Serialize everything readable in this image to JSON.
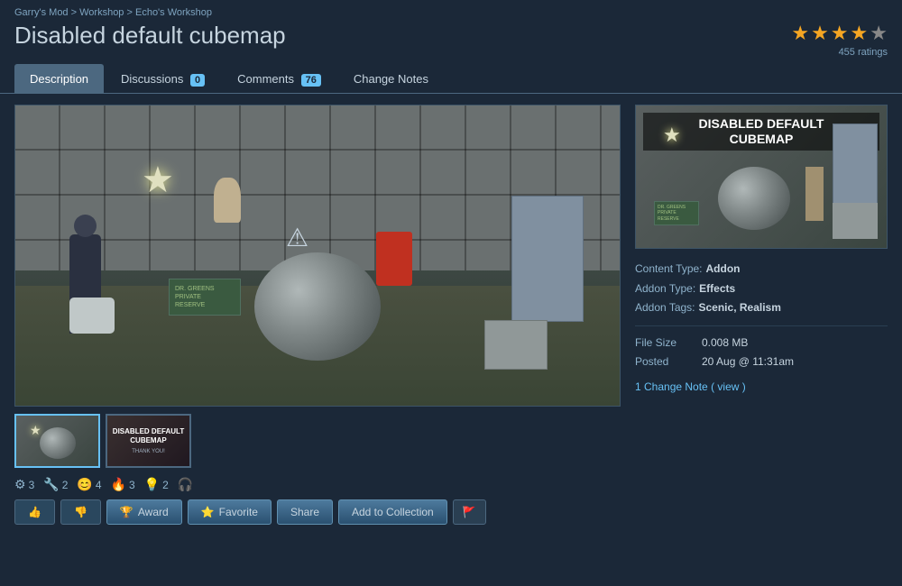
{
  "breadcrumb": {
    "parts": [
      {
        "label": "Garry's Mod",
        "url": "#"
      },
      {
        "label": "Workshop",
        "url": "#"
      },
      {
        "label": "Echo's Workshop",
        "url": "#"
      }
    ],
    "separator": " > "
  },
  "page": {
    "title": "Disabled default cubemap"
  },
  "rating": {
    "stars": 4.5,
    "count": "455 ratings"
  },
  "tabs": [
    {
      "id": "description",
      "label": "Description",
      "badge": null,
      "active": true
    },
    {
      "id": "discussions",
      "label": "Discussions",
      "badge": "0",
      "active": false
    },
    {
      "id": "comments",
      "label": "Comments",
      "badge": "76",
      "active": false
    },
    {
      "id": "change-notes",
      "label": "Change Notes",
      "badge": null,
      "active": false
    }
  ],
  "addon_preview": {
    "title_line1": "DISABLED DEFAULT",
    "title_line2": "CUBEMAP"
  },
  "metadata": {
    "content_type_label": "Content Type:",
    "content_type_value": "Addon",
    "addon_type_label": "Addon Type:",
    "addon_type_value": "Effects",
    "addon_tags_label": "Addon Tags:",
    "addon_tags_value": "Scenic, Realism",
    "file_size_label": "File Size",
    "file_size_value": "0.008 MB",
    "posted_label": "Posted",
    "posted_value": "20 Aug @ 11:31am",
    "change_note_text": "1 Change Note",
    "change_note_link": "( view )"
  },
  "reactions": [
    {
      "icon": "⚙",
      "count": "3"
    },
    {
      "icon": "🔧",
      "count": "2"
    },
    {
      "icon": "😊",
      "count": "4"
    },
    {
      "icon": "🔥",
      "count": "3"
    },
    {
      "icon": "💡",
      "count": "2"
    },
    {
      "icon": "🎧",
      "count": ""
    }
  ],
  "action_buttons": [
    {
      "id": "thumbs-up",
      "label": "👍",
      "type": "icon-only"
    },
    {
      "id": "thumbs-down",
      "label": "👎",
      "type": "icon-only"
    },
    {
      "id": "award",
      "label": "Award",
      "icon": "🏆"
    },
    {
      "id": "favorite",
      "label": "Favorite",
      "icon": "⭐"
    },
    {
      "id": "share",
      "label": "Share"
    },
    {
      "id": "add-to-collection",
      "label": "Add to Collection"
    },
    {
      "id": "flag",
      "label": "🚩",
      "type": "icon-only"
    }
  ]
}
